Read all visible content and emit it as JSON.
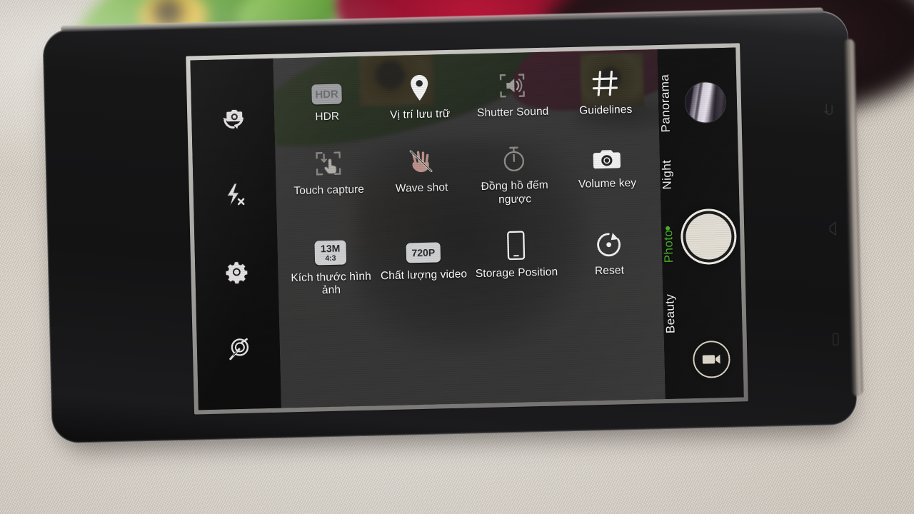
{
  "scene": {
    "description": "Photo of a smartphone held in landscape showing the camera app settings overlay, resting on cream linen cloth with blurred colored yarn spools behind"
  },
  "camera_app": {
    "left_toolbar": [
      {
        "name": "switch-camera",
        "icon": "camera-switch-icon",
        "state": "enabled"
      },
      {
        "name": "flash",
        "icon": "flash-off-icon",
        "state": "off"
      },
      {
        "name": "settings",
        "icon": "gear-icon",
        "state": "active"
      },
      {
        "name": "filters",
        "icon": "filter-wand-icon",
        "state": "enabled"
      }
    ],
    "settings_panel": {
      "rows": [
        [
          {
            "label": "HDR",
            "icon": "hdr-badge-icon",
            "badge": "HDR",
            "state": "off"
          },
          {
            "label": "Vị trí lưu trữ",
            "icon": "location-pin-icon",
            "state": "on"
          },
          {
            "label": "Shutter Sound",
            "icon": "shutter-sound-icon",
            "state": "off"
          },
          {
            "label": "Guidelines",
            "icon": "grid-guidelines-icon",
            "state": "on"
          }
        ],
        [
          {
            "label": "Touch capture",
            "icon": "touch-capture-icon",
            "state": "off"
          },
          {
            "label": "Wave shot",
            "icon": "wave-hand-icon",
            "state": "off"
          },
          {
            "label": "Đồng hồ đếm ngược",
            "icon": "timer-icon",
            "state": "off"
          },
          {
            "label": "Volume key",
            "icon": "camera-icon",
            "state": "on"
          }
        ],
        [
          {
            "label": "Kích thước hình ảnh",
            "icon": "photo-size-badge-icon",
            "badge_primary": "13M",
            "badge_secondary": "4:3",
            "state": "on"
          },
          {
            "label": "Chất lượng video",
            "icon": "video-quality-badge-icon",
            "badge": "720P",
            "state": "on"
          },
          {
            "label": "Storage Position",
            "icon": "phone-storage-icon",
            "state": "on"
          },
          {
            "label": "Reset",
            "icon": "reset-icon",
            "state": "on"
          }
        ]
      ]
    },
    "mode_rail": {
      "modes": [
        {
          "label": "Panorama",
          "active": false
        },
        {
          "label": "Night",
          "active": false
        },
        {
          "label": "Photo",
          "active": true
        },
        {
          "label": "Beauty",
          "active": false
        }
      ],
      "active_color": "#49b02a"
    },
    "right_controls": {
      "thumbnail": "last-photo-thumbnail",
      "shutter": "shutter-button",
      "video": "video-record-button"
    }
  },
  "device": {
    "nav_bar": [
      {
        "name": "recents",
        "icon": "recents-icon"
      },
      {
        "name": "home",
        "icon": "home-icon"
      },
      {
        "name": "back",
        "icon": "back-icon"
      }
    ]
  },
  "colors": {
    "panel_bg": "#242425",
    "accent_green": "#49b02a",
    "icon_white": "#fbfbfb",
    "badge_grey": "#cfd0d2",
    "bezel": "#9c9a97"
  }
}
